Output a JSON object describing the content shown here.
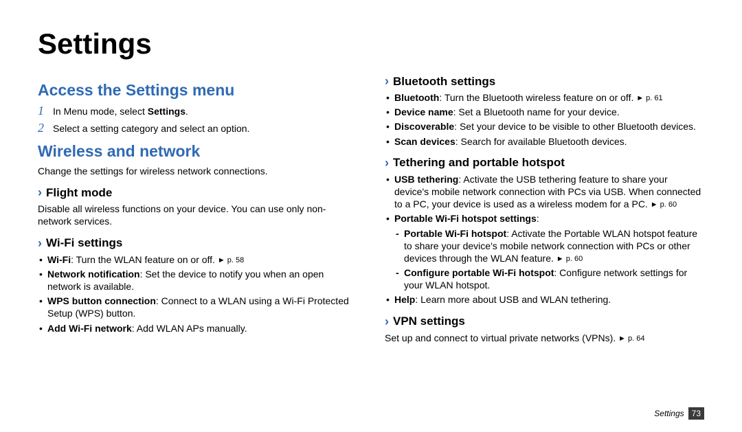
{
  "page": {
    "title": "Settings",
    "footer_label": "Settings",
    "footer_page": "73"
  },
  "left": {
    "access": {
      "heading": "Access the Settings menu",
      "steps": [
        {
          "num": "1",
          "pre": "In Menu mode, select ",
          "bold": "Settings",
          "post": "."
        },
        {
          "num": "2",
          "pre": "Select a setting category and select an option.",
          "bold": "",
          "post": ""
        }
      ]
    },
    "wireless": {
      "heading": "Wireless and network",
      "intro": "Change the settings for wireless network connections.",
      "flight": {
        "heading": "Flight mode",
        "body": "Disable all wireless functions on your device. You can use only non-network services."
      },
      "wifi": {
        "heading": "Wi-Fi settings",
        "items": [
          {
            "bold": "Wi-Fi",
            "text": ": Turn the WLAN feature on or off. ",
            "ref": "► p. 58"
          },
          {
            "bold": "Network notification",
            "text": ": Set the device to notify you when an open network is available.",
            "ref": ""
          },
          {
            "bold": "WPS button connection",
            "text": ": Connect to a WLAN using a Wi-Fi Protected Setup (WPS) button.",
            "ref": ""
          },
          {
            "bold": "Add Wi-Fi network",
            "text": ": Add WLAN APs manually.",
            "ref": ""
          }
        ]
      }
    }
  },
  "right": {
    "bluetooth": {
      "heading": "Bluetooth settings",
      "items": [
        {
          "bold": "Bluetooth",
          "text": ": Turn the Bluetooth wireless feature on or off. ",
          "ref": "► p. 61"
        },
        {
          "bold": "Device name",
          "text": ": Set a Bluetooth name for your device.",
          "ref": ""
        },
        {
          "bold": "Discoverable",
          "text": ": Set your device to be visible to other Bluetooth devices.",
          "ref": ""
        },
        {
          "bold": "Scan devices",
          "text": ": Search for available Bluetooth devices.",
          "ref": ""
        }
      ]
    },
    "tether": {
      "heading": "Tethering and portable hotspot",
      "usb": {
        "bold": "USB tethering",
        "text": ": Activate the USB tethering feature to share your device's mobile network connection with PCs via USB. When connected to a PC, your device is used as a wireless modem for a PC. ",
        "ref": "► p. 60"
      },
      "portable_label": "Portable Wi-Fi hotspot settings",
      "portable_sub": [
        {
          "bold": "Portable Wi-Fi hotspot",
          "text": ": Activate the Portable WLAN hotspot feature to share your device's mobile network connection with PCs or other devices through the WLAN feature. ",
          "ref": "► p. 60"
        },
        {
          "bold": "Configure portable Wi-Fi hotspot",
          "text": ": Configure network settings for your WLAN hotspot.",
          "ref": ""
        }
      ],
      "help": {
        "bold": "Help",
        "text": ": Learn more about USB and WLAN tethering.",
        "ref": ""
      }
    },
    "vpn": {
      "heading": "VPN settings",
      "body": "Set up and connect to virtual private networks (VPNs). ",
      "ref": "► p. 64"
    }
  }
}
